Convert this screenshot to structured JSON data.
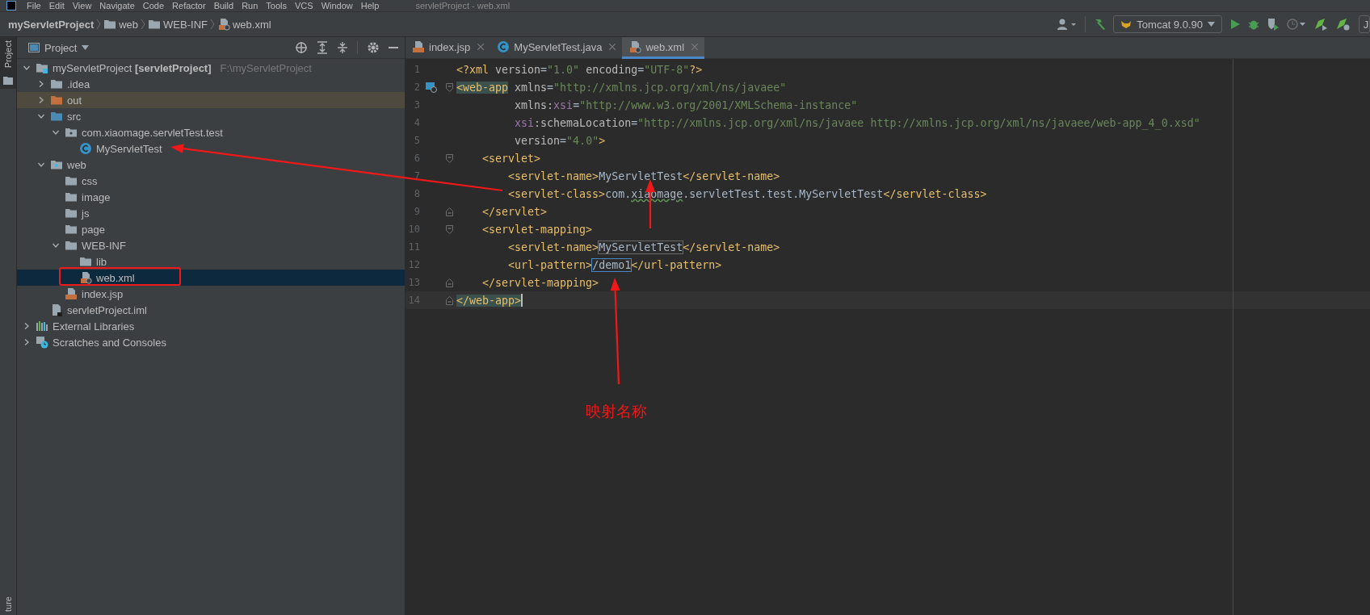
{
  "menu_bar": {
    "items": [
      "File",
      "Edit",
      "View",
      "Navigate",
      "Code",
      "Refactor",
      "Build",
      "Run",
      "Tools",
      "VCS",
      "Window",
      "Help"
    ],
    "title": "servletProject - web.xml"
  },
  "breadcrumbs": [
    {
      "label": "myServletProject",
      "kind": "project"
    },
    {
      "label": "web",
      "kind": "folder"
    },
    {
      "label": "WEB-INF",
      "kind": "folder"
    },
    {
      "label": "web.xml",
      "kind": "xml"
    }
  ],
  "toolbar": {
    "run_config": "Tomcat 9.0.90",
    "cut_button": "J"
  },
  "side_stripe": {
    "top_label": "Project",
    "bottom_label": "ture"
  },
  "project_panel": {
    "title": "Project",
    "tree": [
      {
        "label": "myServletProject **[servletProject]**",
        "hint": "F:\\myServletProject",
        "kind": "module",
        "expanded": true,
        "selected": false,
        "children": [
          {
            "label": ".idea",
            "kind": "folder",
            "expanded": false,
            "selected": false
          },
          {
            "label": "out",
            "kind": "excluded",
            "expanded": false,
            "selected": false
          },
          {
            "label": "src",
            "kind": "source",
            "expanded": true,
            "selected": false,
            "children": [
              {
                "label": "com.xiaomage.servletTest.test",
                "kind": "package",
                "expanded": true,
                "selected": false,
                "children": [
                  {
                    "label": "MyServletTest",
                    "kind": "class",
                    "selected": false
                  }
                ]
              }
            ]
          },
          {
            "label": "web",
            "kind": "web",
            "expanded": true,
            "selected": false,
            "children": [
              {
                "label": "css",
                "kind": "folder",
                "selected": false
              },
              {
                "label": "image",
                "kind": "folder",
                "selected": false
              },
              {
                "label": "js",
                "kind": "folder",
                "selected": false
              },
              {
                "label": "page",
                "kind": "folder",
                "selected": false
              },
              {
                "label": "WEB-INF",
                "kind": "folder",
                "expanded": true,
                "selected": false,
                "children": [
                  {
                    "label": "lib",
                    "kind": "folder",
                    "selected": false
                  },
                  {
                    "label": "web.xml",
                    "kind": "xml",
                    "selected": true
                  }
                ]
              },
              {
                "label": "index.jsp",
                "kind": "jsp",
                "selected": false
              }
            ]
          },
          {
            "label": "servletProject.iml",
            "kind": "iml",
            "selected": false
          }
        ]
      },
      {
        "label": "External Libraries",
        "kind": "libraries",
        "expanded": false,
        "selected": false
      },
      {
        "label": "Scratches and Consoles",
        "kind": "scratches",
        "expanded": false,
        "selected": false
      }
    ]
  },
  "editor": {
    "tabs": [
      {
        "label": "index.jsp",
        "kind": "jsp",
        "selected": false
      },
      {
        "label": "MyServletTest.java",
        "kind": "class",
        "selected": false
      },
      {
        "label": "web.xml",
        "kind": "xml",
        "selected": true
      }
    ],
    "lines": [
      {
        "number": "1",
        "fold_open": false,
        "fold_close": false,
        "gutter_icon": false,
        "current": false,
        "tokens": [
          {
            "text": "<?xml",
            "kind": "tag"
          },
          {
            "text": " version",
            "kind": "attr"
          },
          {
            "text": "=",
            "kind": "plain"
          },
          {
            "text": "\"1.0\"",
            "kind": "value"
          },
          {
            "text": " encoding",
            "kind": "attr"
          },
          {
            "text": "=",
            "kind": "plain"
          },
          {
            "text": "\"UTF-8\"",
            "kind": "value"
          },
          {
            "text": "?>",
            "kind": "tag"
          }
        ]
      },
      {
        "number": "2",
        "fold_open": true,
        "fold_close": false,
        "gutter_icon": true,
        "current": false,
        "tokens": [
          {
            "text": "<web-app",
            "kind": "tag",
            "matched": true
          },
          {
            "text": " xmlns",
            "kind": "attr"
          },
          {
            "text": "=",
            "kind": "plain"
          },
          {
            "text": "\"http://xmlns.jcp.org/xml/ns/javaee\"",
            "kind": "value"
          }
        ]
      },
      {
        "number": "3",
        "fold_open": false,
        "fold_close": false,
        "gutter_icon": false,
        "current": false,
        "tokens": [
          {
            "text": "         xmlns:",
            "kind": "attr"
          },
          {
            "text": "xsi",
            "kind": "ns"
          },
          {
            "text": "=",
            "kind": "plain"
          },
          {
            "text": "\"http://www.w3.org/2001/XMLSchema-instance\"",
            "kind": "value"
          }
        ]
      },
      {
        "number": "4",
        "fold_open": false,
        "fold_close": false,
        "gutter_icon": false,
        "current": false,
        "tokens": [
          {
            "text": "         xsi",
            "kind": "ns"
          },
          {
            "text": ":schemaLocation",
            "kind": "attr"
          },
          {
            "text": "=",
            "kind": "plain"
          },
          {
            "text": "\"http://xmlns.jcp.org/xml/ns/javaee http://xmlns.jcp.org/xml/ns/javaee/web-app_4_0.xsd\"",
            "kind": "value"
          }
        ]
      },
      {
        "number": "5",
        "fold_open": false,
        "fold_close": false,
        "gutter_icon": false,
        "current": false,
        "tokens": [
          {
            "text": "         version",
            "kind": "attr"
          },
          {
            "text": "=",
            "kind": "plain"
          },
          {
            "text": "\"4.0\"",
            "kind": "value"
          },
          {
            "text": ">",
            "kind": "tag"
          }
        ]
      },
      {
        "number": "6",
        "fold_open": true,
        "fold_close": false,
        "gutter_icon": false,
        "current": false,
        "tokens": [
          {
            "text": "    <servlet>",
            "kind": "tag"
          }
        ]
      },
      {
        "number": "7",
        "fold_open": false,
        "fold_close": false,
        "gutter_icon": false,
        "current": false,
        "tokens": [
          {
            "text": "        <servlet-name>",
            "kind": "tag"
          },
          {
            "text": "MyServletTest",
            "kind": "text"
          },
          {
            "text": "</servlet-name>",
            "kind": "tag"
          }
        ]
      },
      {
        "number": "8",
        "fold_open": false,
        "fold_close": false,
        "gutter_icon": false,
        "current": false,
        "tokens": [
          {
            "text": "        <servlet-class>",
            "kind": "tag"
          },
          {
            "text": "com.",
            "kind": "text"
          },
          {
            "text": "xiaomage",
            "kind": "text",
            "typo": true
          },
          {
            "text": ".servletTest.test.MyServletTest",
            "kind": "text"
          },
          {
            "text": "</servlet-class>",
            "kind": "tag"
          }
        ]
      },
      {
        "number": "9",
        "fold_open": false,
        "fold_close": true,
        "gutter_icon": false,
        "current": false,
        "tokens": [
          {
            "text": "    </servlet>",
            "kind": "tag"
          }
        ]
      },
      {
        "number": "10",
        "fold_open": true,
        "fold_close": false,
        "gutter_icon": false,
        "current": false,
        "tokens": [
          {
            "text": "    <servlet-mapping>",
            "kind": "tag"
          }
        ]
      },
      {
        "number": "11",
        "fold_open": false,
        "fold_close": false,
        "gutter_icon": false,
        "current": false,
        "tokens": [
          {
            "text": "        <servlet-name>",
            "kind": "tag"
          },
          {
            "text": "MyServletTest",
            "kind": "text",
            "boxed": true
          },
          {
            "text": "</servlet-name>",
            "kind": "tag"
          }
        ]
      },
      {
        "number": "12",
        "fold_open": false,
        "fold_close": false,
        "gutter_icon": false,
        "current": false,
        "tokens": [
          {
            "text": "        <url-pattern>",
            "kind": "tag"
          },
          {
            "text": "/demo1",
            "kind": "text",
            "focused": true
          },
          {
            "text": "</url-pattern>",
            "kind": "tag"
          }
        ]
      },
      {
        "number": "13",
        "fold_open": false,
        "fold_close": true,
        "gutter_icon": false,
        "current": false,
        "tokens": [
          {
            "text": "    </servlet-mapping>",
            "kind": "tag"
          }
        ]
      },
      {
        "number": "14",
        "fold_open": false,
        "fold_close": true,
        "gutter_icon": false,
        "current": true,
        "tokens": [
          {
            "text": "</web-app>",
            "kind": "tag",
            "matched": true
          }
        ]
      }
    ]
  },
  "annotation": {
    "label": "映射名称"
  }
}
